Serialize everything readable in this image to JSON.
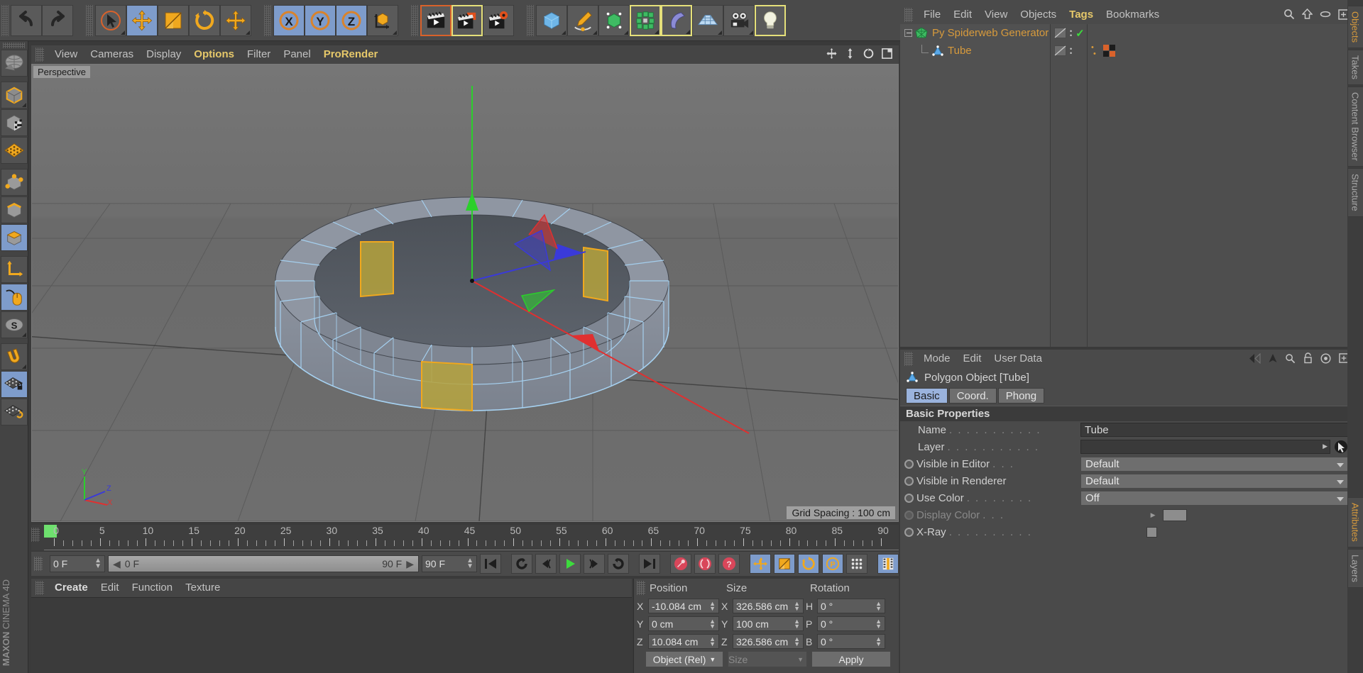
{
  "app": {
    "brand_line1": "MAXON",
    "brand_line2": "CINEMA 4D"
  },
  "top_toolbar": {
    "groups": [
      {
        "name": "undo-redo",
        "buttons": [
          {
            "label": "Undo",
            "icon": "undo-icon",
            "state": "normal"
          },
          {
            "label": "Redo",
            "icon": "redo-icon",
            "state": "normal"
          }
        ]
      },
      {
        "name": "tools",
        "buttons": [
          {
            "label": "Live Selection",
            "icon": "cursor-select-icon",
            "state": "normal"
          },
          {
            "label": "Move",
            "icon": "move-icon",
            "state": "selected"
          },
          {
            "label": "Scale",
            "icon": "scale-icon",
            "state": "normal"
          },
          {
            "label": "Rotate",
            "icon": "rotate-icon",
            "state": "normal"
          },
          {
            "label": "Move Tool Group",
            "icon": "move-group-icon",
            "state": "normal"
          }
        ]
      },
      {
        "name": "axis-locks",
        "buttons": [
          {
            "label": "X Axis",
            "icon": "axis-x-icon",
            "state": "selected"
          },
          {
            "label": "Y Axis",
            "icon": "axis-y-icon",
            "state": "selected"
          },
          {
            "label": "Z Axis",
            "icon": "axis-z-icon",
            "state": "selected"
          },
          {
            "label": "World/Object Coordinate System",
            "icon": "world-coord-icon",
            "state": "normal"
          }
        ]
      },
      {
        "name": "render",
        "buttons": [
          {
            "label": "Render View",
            "icon": "render-view-icon",
            "state": "outline-orange"
          },
          {
            "label": "Render to Picture Viewer",
            "icon": "render-picture-icon",
            "state": "outline-yellow"
          },
          {
            "label": "Edit Render Settings",
            "icon": "render-settings-icon",
            "state": "normal"
          }
        ]
      },
      {
        "name": "objects",
        "buttons": [
          {
            "label": "Cube / Primitives",
            "icon": "cube-icon",
            "state": "normal"
          },
          {
            "label": "Pen / Splines",
            "icon": "pen-spline-icon",
            "state": "normal"
          },
          {
            "label": "Subdivision Surface / Generators",
            "icon": "generator-icon",
            "state": "normal"
          },
          {
            "label": "MoGraph Cloner",
            "icon": "mograph-icon",
            "state": "outline-yellow"
          },
          {
            "label": "Bend / Deformers",
            "icon": "deformer-icon",
            "state": "outline-yellow"
          },
          {
            "label": "Floor / Scene",
            "icon": "floor-scene-icon",
            "state": "normal"
          },
          {
            "label": "Camera",
            "icon": "camera-icon",
            "state": "normal"
          },
          {
            "label": "Light",
            "icon": "light-bulb-icon",
            "state": "outline-yellow"
          }
        ]
      }
    ]
  },
  "left_toolbar": {
    "buttons": [
      {
        "label": "Make Editable",
        "icon": "make-editable-icon",
        "state": "normal"
      },
      {
        "label": "Model Mode",
        "icon": "model-mode-icon",
        "state": "normal"
      },
      {
        "label": "Texture Mode",
        "icon": "texture-mode-icon",
        "state": "normal"
      },
      {
        "label": "Workplane Mode",
        "icon": "workplane-icon",
        "state": "normal"
      },
      {
        "label": "Points Mode",
        "icon": "points-mode-icon",
        "state": "normal"
      },
      {
        "label": "Edges Mode",
        "icon": "edges-mode-icon",
        "state": "normal"
      },
      {
        "label": "Polygons Mode",
        "icon": "polygons-mode-icon",
        "state": "selected"
      },
      {
        "label": "Enable Axis Modification",
        "icon": "axis-modify-icon",
        "state": "normal"
      },
      {
        "label": "Viewport Solo",
        "icon": "mouse-icon",
        "state": "selected"
      },
      {
        "label": "Soft Selection",
        "icon": "soft-selection-icon",
        "state": "selected"
      },
      {
        "label": "Snap",
        "icon": "magnet-snap-icon",
        "state": "normal"
      },
      {
        "label": "Workplane Lock",
        "icon": "workplane-lock-icon",
        "state": "selected"
      },
      {
        "label": "Planar Workplane",
        "icon": "planar-workplane-icon",
        "state": "normal"
      }
    ]
  },
  "viewport": {
    "menu": [
      "View",
      "Cameras",
      "Display",
      "Options",
      "Filter",
      "Panel",
      "ProRender"
    ],
    "highlighted_menu": [
      "Options",
      "ProRender"
    ],
    "label": "Perspective",
    "grid_spacing": "Grid Spacing : 100 cm",
    "axis_gizmo": {
      "x": "X",
      "y": "Y",
      "z": "Z"
    },
    "icons": [
      "move-view-icon",
      "pan-view-icon",
      "rotate-view-icon",
      "maximize-view-icon"
    ]
  },
  "timeline": {
    "ticks": [
      "0",
      "5",
      "10",
      "15",
      "20",
      "25",
      "30",
      "35",
      "40",
      "45",
      "50",
      "55",
      "60",
      "65",
      "70",
      "75",
      "80",
      "85",
      "90"
    ],
    "current_frame": "0 F",
    "range_start": "0 F",
    "range_end": "90 F",
    "max_frame": "90 F",
    "preview_frame": "0 F",
    "transport": [
      {
        "label": "Go to Start",
        "icon": "skip-start-icon"
      },
      {
        "label": "Go to Previous Key",
        "icon": "prev-key-icon"
      },
      {
        "label": "Go to Previous Frame",
        "icon": "step-back-icon"
      },
      {
        "label": "Play Forwards",
        "icon": "play-icon"
      },
      {
        "label": "Go to Next Frame",
        "icon": "step-forward-icon"
      },
      {
        "label": "Go to Next Key",
        "icon": "next-key-icon"
      },
      {
        "label": "Go to End",
        "icon": "skip-end-icon"
      }
    ],
    "record_tools": [
      {
        "label": "Record Active Objects",
        "icon": "record-key-icon"
      },
      {
        "label": "Autokeying",
        "icon": "autokey-icon"
      },
      {
        "label": "Keyframe Selection",
        "icon": "keyframe-select-icon"
      }
    ],
    "key_toggles": [
      {
        "label": "Position",
        "icon": "key-position-icon",
        "state": "selected"
      },
      {
        "label": "Scale",
        "icon": "key-scale-icon",
        "state": "selected"
      },
      {
        "label": "Rotation",
        "icon": "key-rotation-icon",
        "state": "selected"
      },
      {
        "label": "Parameter",
        "icon": "key-parameter-icon",
        "state": "selected"
      },
      {
        "label": "Point Level Animation",
        "icon": "key-pla-icon",
        "state": "normal"
      },
      {
        "label": "Timeline Mode",
        "icon": "timeline-mode-icon",
        "state": "selected"
      }
    ]
  },
  "material_manager": {
    "menu": [
      "Create",
      "Edit",
      "Function",
      "Texture"
    ],
    "highlighted_menu": [
      "Create"
    ]
  },
  "coordinates": {
    "headers": {
      "position": "Position",
      "size": "Size",
      "rotation": "Rotation"
    },
    "rows": [
      {
        "pos_axis": "X",
        "pos_value": "-10.084 cm",
        "size_axis": "X",
        "size_value": "326.586 cm",
        "rot_axis": "H",
        "rot_value": "0 °"
      },
      {
        "pos_axis": "Y",
        "pos_value": "0 cm",
        "size_axis": "Y",
        "size_value": "100 cm",
        "rot_axis": "P",
        "rot_value": "0 °"
      },
      {
        "pos_axis": "Z",
        "pos_value": "10.084 cm",
        "size_axis": "Z",
        "size_value": "326.586 cm",
        "rot_axis": "B",
        "rot_value": "0 °"
      }
    ],
    "mode_dropdown": "Object (Rel)",
    "size_dropdown": "Size",
    "apply_button": "Apply"
  },
  "object_manager": {
    "menu": [
      "File",
      "Edit",
      "View",
      "Objects",
      "Tags",
      "Bookmarks"
    ],
    "highlighted_menu": [
      "Tags"
    ],
    "icons": [
      "search-icon",
      "home-icon",
      "ellipse-icon",
      "fit-icon"
    ],
    "tree": [
      {
        "name": "Py Spiderweb Generator",
        "icon": "mograph-green-icon",
        "depth": 0,
        "has_expander": true,
        "visible_check": true
      },
      {
        "name": "Tube",
        "icon": "polygon-object-icon",
        "depth": 1,
        "has_expander": false,
        "visible_check": false
      }
    ]
  },
  "attribute_manager": {
    "menu": [
      "Mode",
      "Edit",
      "User Data"
    ],
    "icons": [
      "back-icon",
      "forward-icon",
      "up-icon",
      "search-icon",
      "lock-icon",
      "target-icon",
      "fit-icon"
    ],
    "object_title": "Polygon Object [Tube]",
    "object_icon": "polygon-object-icon",
    "tabs": [
      {
        "label": "Basic",
        "selected": true
      },
      {
        "label": "Coord.",
        "selected": false
      },
      {
        "label": "Phong",
        "selected": false
      }
    ],
    "section_title": "Basic Properties",
    "properties": [
      {
        "label": "Name",
        "type": "text",
        "value": "Tube",
        "dots": true,
        "radio": false,
        "dimmed": false
      },
      {
        "label": "Layer",
        "type": "layer",
        "value": "",
        "dots": true,
        "radio": false,
        "dimmed": false
      },
      {
        "label": "Visible in Editor",
        "type": "select",
        "value": "Default",
        "dots": true,
        "radio": true,
        "dimmed": false
      },
      {
        "label": "Visible in Renderer",
        "type": "select",
        "value": "Default",
        "dots": false,
        "radio": true,
        "dimmed": false
      },
      {
        "label": "Use Color",
        "type": "select",
        "value": "Off",
        "dots": true,
        "radio": true,
        "dimmed": false
      },
      {
        "label": "Display Color",
        "type": "swatch",
        "value": "",
        "dots": true,
        "radio": true,
        "dimmed": true
      },
      {
        "label": "X-Ray",
        "type": "checkbox",
        "value": "",
        "dots": true,
        "radio": true,
        "dimmed": false
      }
    ]
  },
  "right_tabs": [
    {
      "label": "Objects",
      "active": true
    },
    {
      "label": "Takes",
      "active": false
    },
    {
      "label": "Content Browser",
      "active": false
    },
    {
      "label": "Structure",
      "active": false
    },
    {
      "label": "Attributes",
      "active": true
    },
    {
      "label": "Layers",
      "active": false
    }
  ],
  "colors": {
    "accent_orange": "#d79a3c",
    "selection_blue": "#7e9ccb",
    "highlight_yellow": "#e5e07a",
    "panel_bg": "#4a4a4a",
    "viewport_bg": "#6b6b6b",
    "selected_poly": "#b5a23c",
    "wireframe": "#9ec9f0"
  }
}
